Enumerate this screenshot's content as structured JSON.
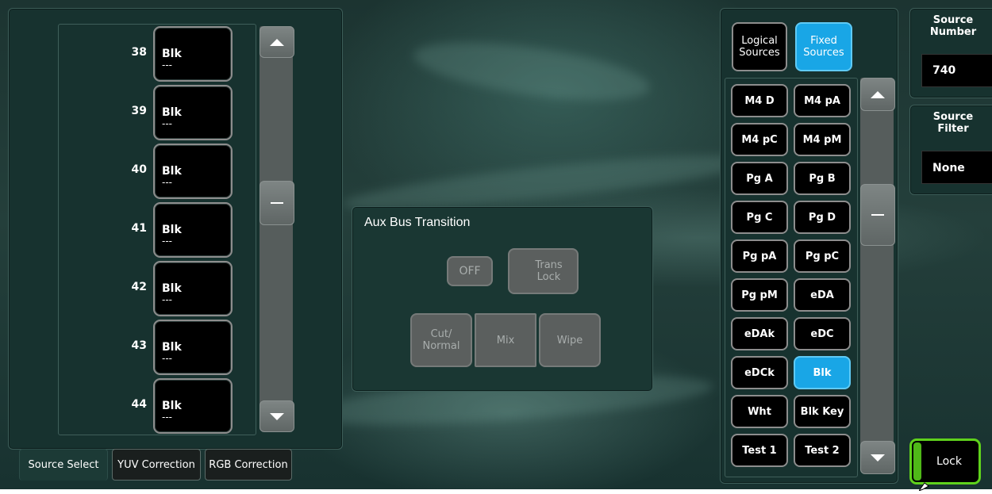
{
  "source_list": {
    "rows": [
      {
        "number": "38",
        "name": "Blk",
        "sub": "---"
      },
      {
        "number": "39",
        "name": "Blk",
        "sub": "---"
      },
      {
        "number": "40",
        "name": "Blk",
        "sub": "---"
      },
      {
        "number": "41",
        "name": "Blk",
        "sub": "---"
      },
      {
        "number": "42",
        "name": "Blk",
        "sub": "---"
      },
      {
        "number": "43",
        "name": "Blk",
        "sub": "---"
      },
      {
        "number": "44",
        "name": "Blk",
        "sub": "---"
      }
    ]
  },
  "tabs": [
    {
      "label": "Source Select",
      "active": true
    },
    {
      "label": "YUV Correction",
      "active": false
    },
    {
      "label": "RGB Correction",
      "active": false
    }
  ],
  "aux_transition": {
    "title": "Aux Bus Transition",
    "off_label": "OFF",
    "trans_lock_label": "Trans\nLock",
    "cut_label": "Cut/\nNormal",
    "mix_label": "Mix",
    "wipe_label": "Wipe"
  },
  "source_mode": {
    "logical_label": "Logical\nSources",
    "fixed_label": "Fixed\nSources",
    "selected": "fixed"
  },
  "fixed_sources": [
    [
      "M4 D",
      "M4 pA"
    ],
    [
      "M4 pC",
      "M4 pM"
    ],
    [
      "Pg A",
      "Pg B"
    ],
    [
      "Pg C",
      "Pg D"
    ],
    [
      "Pg pA",
      "Pg pC"
    ],
    [
      "Pg pM",
      "eDA"
    ],
    [
      "eDAk",
      "eDC"
    ],
    [
      "eDCk",
      "Blk"
    ],
    [
      "Wht",
      "Blk Key"
    ],
    [
      "Test 1",
      "Test 2"
    ]
  ],
  "selected_source": "Blk",
  "source_number": {
    "label": "Source\nNumber",
    "value": "740"
  },
  "source_filter": {
    "label": "Source\nFilter",
    "value": "None"
  },
  "lock_label": "Lock",
  "colors": {
    "accent": "#19a6e6",
    "panel": "#17322f",
    "lock_border": "#5fd21c"
  }
}
